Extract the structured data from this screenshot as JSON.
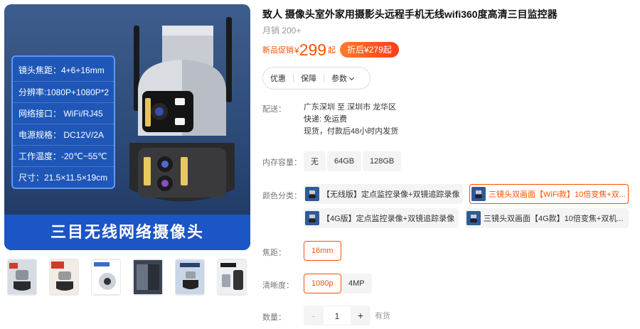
{
  "gallery": {
    "specs": [
      "镜头焦距：4+6+16mm",
      "分辨率:1080P+1080P*2",
      "网络接口： WiFi/RJ45",
      "电源规格： DC12V/2A",
      "工作温度：-20℃~55℃",
      "尺寸：21.5×11.5×19cm"
    ],
    "banner": "三目无线网络摄像头",
    "thumbnail_count": 6
  },
  "product": {
    "title": "致人 摄像头室外家用摄影头远程手机无线wifi360度高清三目监控器",
    "sales": "月销 200+",
    "price_label": "新品促销",
    "currency": "¥",
    "price": "299",
    "price_suffix": "起",
    "discount": "折后¥279起"
  },
  "tabs": [
    "优惠",
    "保障",
    "参数"
  ],
  "shipping": {
    "label": "配送：",
    "route": "广东深圳 至 深圳市 龙华区",
    "fee": "快递: 免运费",
    "dispatch": "现货，付款后48小时内发货"
  },
  "memory": {
    "label": "内存容量：",
    "options": [
      "无",
      "64GB",
      "128GB"
    ]
  },
  "color": {
    "label": "颜色分类：",
    "options": [
      "【无线版】定点监控录像+双镜追踪录像",
      "三镜头双画面【WiFi款】10倍变焦+双...",
      "【4G版】定点监控录像+双镜追踪录像",
      "三镜头双画面【4G款】10倍变焦+双机..."
    ],
    "selected": 1
  },
  "focal": {
    "label": "焦距：",
    "options": [
      "16mm"
    ]
  },
  "resolution": {
    "label": "清晰度：",
    "options": [
      "1080p",
      "4MP"
    ]
  },
  "quantity": {
    "label": "数量：",
    "minus": "-",
    "value": "1",
    "plus": "+",
    "stock": "有货"
  },
  "colors": {
    "accent": "#ff5000",
    "banner": "#1c55c6"
  }
}
